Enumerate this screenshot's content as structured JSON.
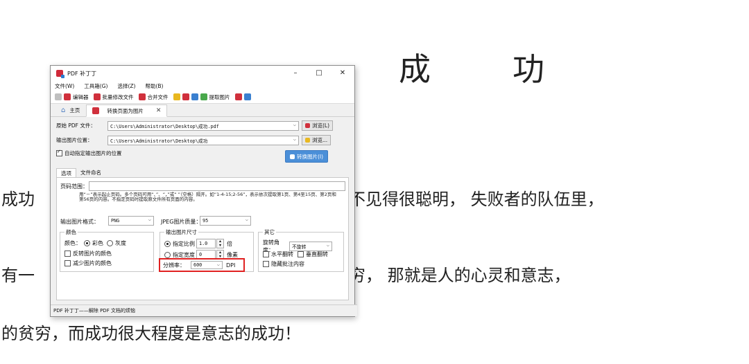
{
  "document": {
    "title_chars": [
      "成",
      "功"
    ],
    "line1_left": "成功",
    "line1_right": "不见得很聪明，   失败者的队伍里，",
    "line2_left": "有一",
    "line2_right": "穷，   那就是人的心灵和意志，",
    "line3": "的贫穷，而成功很大程度是意志的成功！"
  },
  "window": {
    "title": "PDF 补丁丁",
    "controls": [
      "–",
      "□",
      "✕"
    ],
    "menu": [
      "文件(W)",
      "工具箱(G)",
      "选择(Z)",
      "帮助(B)"
    ],
    "toolbar": [
      "编辑器",
      "批量修改文件",
      "合并文件",
      "提取图片"
    ],
    "tabs": {
      "home": "主页",
      "convert": "转换页面为图片",
      "close": "✕"
    },
    "source_label": "原始 PDF 文件：",
    "source_value": "C:\\Users\\Administrator\\Desktop\\成功.pdf",
    "browse1": "浏览(L)",
    "output_label": "输出图片位置：",
    "output_value": "C:\\Users\\Administrator\\Desktop\\成功",
    "browse2": "浏览...",
    "auto_output": "自动指定输出图片的位置",
    "auto_output_checked": true,
    "convert_button": "转换图片(I)",
    "subtabs": [
      "选项",
      "文件命名"
    ],
    "page_range_label": "页码范围：",
    "page_range_value": "",
    "hint": "用“－”表示起止页码。多个页码可用“、”、“，”或“ ”（空格）隔开。如“1-4-15;2-56”，表示依次提取第1页、第4至15页、第2页和第56页的内容。不指定页码时提取原文件所有页面的内容。",
    "format_label": "输出图片格式：",
    "format_value": "PNG",
    "jpeg_label": "JPEG图片质量：",
    "jpeg_value": "95",
    "color_group": "颜色",
    "color_label": "颜色：",
    "color_option1": "彩色",
    "color_option2": "灰度",
    "invert": "反转图片的颜色",
    "reduce": "减少图片的颜色",
    "size_group": "输出图片尺寸",
    "scale_label": "指定比例",
    "scale_value": "1.0",
    "scale_unit": "倍",
    "width_label": "指定宽度",
    "width_value": "0",
    "width_unit": "像素",
    "dpi_label": "分辨率：",
    "dpi_value": "600",
    "dpi_unit": "DPI",
    "other_group": "其它",
    "rotate_label": "旋转角度：",
    "rotate_value": "不旋转",
    "hflip": "水平翻转",
    "vflip": "垂直翻转",
    "hide_annot": "隐藏批注内容",
    "status": "PDF 补丁丁——解除 PDF 文档的烦恼"
  }
}
